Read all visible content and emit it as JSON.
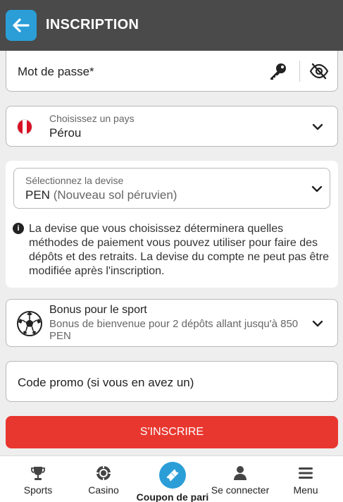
{
  "header": {
    "title": "INSCRIPTION"
  },
  "password": {
    "label": "Mot de passe*"
  },
  "country": {
    "label": "Choisissez un pays",
    "value": "Pérou"
  },
  "currency": {
    "label": "Sélectionnez la devise",
    "code": "PEN",
    "name": "(Nouveau sol péruvien)",
    "info": "La devise que vous choisissez déterminera quelles méthodes de paiement vous pouvez utiliser pour faire des dépôts et des retraits. La devise du compte ne peut pas être modifiée après l'inscription."
  },
  "bonus": {
    "title": "Bonus pour le sport",
    "description": "Bonus de bienvenue pour 2 dépôts allant jusqu'à 850 PEN"
  },
  "promo": {
    "label": "Code promo (si vous en avez un)"
  },
  "submit": {
    "label": "S'INSCRIRE"
  },
  "nav": {
    "items": [
      {
        "label": "Sports",
        "icon": "trophy-icon"
      },
      {
        "label": "Casino",
        "icon": "casino-chip-icon"
      },
      {
        "label": "Coupon de pari",
        "icon": "ticket-icon"
      },
      {
        "label": "Se connecter",
        "icon": "user-icon"
      },
      {
        "label": "Menu",
        "icon": "menu-icon"
      }
    ]
  },
  "colors": {
    "header_bg": "#4a4a4a",
    "accent_blue": "#2b9ed8",
    "submit_red": "#e8372f",
    "flag_red": "#d91023"
  }
}
